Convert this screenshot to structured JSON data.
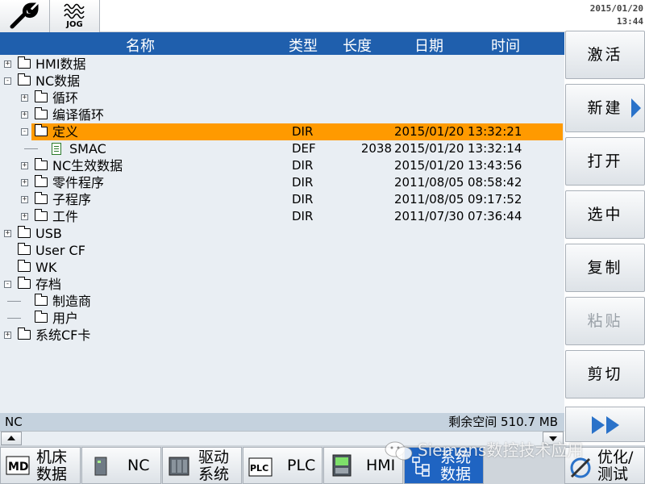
{
  "topbar": {
    "jog_label": "JOG",
    "date": "2015/01/20",
    "time": "13:44"
  },
  "header": {
    "name": "名称",
    "type": "类型",
    "length": "长度",
    "date": "日期",
    "time": "时间"
  },
  "tree": [
    {
      "name": "HMI数据",
      "level": 0,
      "kind": "folder",
      "expander": "+",
      "type": "",
      "length": "",
      "date": "",
      "time": ""
    },
    {
      "name": "NC数据",
      "level": 0,
      "kind": "folder-open",
      "expander": "-",
      "type": "",
      "length": "",
      "date": "",
      "time": ""
    },
    {
      "name": "循环",
      "level": 1,
      "kind": "folder",
      "expander": "+",
      "type": "",
      "length": "",
      "date": "",
      "time": ""
    },
    {
      "name": "编译循环",
      "level": 1,
      "kind": "folder",
      "expander": "+",
      "type": "",
      "length": "",
      "date": "",
      "time": ""
    },
    {
      "name": "定义",
      "level": 1,
      "kind": "folder-open",
      "expander": "-",
      "type": "DIR",
      "length": "",
      "date": "2015/01/20",
      "time": "13:32:21",
      "selected": true
    },
    {
      "name": "SMAC",
      "level": 2,
      "kind": "file",
      "expander": "",
      "type": "DEF",
      "length": "2038",
      "date": "2015/01/20",
      "time": "13:32:14"
    },
    {
      "name": "NC生效数据",
      "level": 1,
      "kind": "folder",
      "expander": "+",
      "type": "DIR",
      "length": "",
      "date": "2015/01/20",
      "time": "13:43:56"
    },
    {
      "name": "零件程序",
      "level": 1,
      "kind": "folder",
      "expander": "+",
      "type": "DIR",
      "length": "",
      "date": "2011/08/05",
      "time": "08:58:42"
    },
    {
      "name": "子程序",
      "level": 1,
      "kind": "folder",
      "expander": "+",
      "type": "DIR",
      "length": "",
      "date": "2011/08/05",
      "time": "09:17:52"
    },
    {
      "name": "工件",
      "level": 1,
      "kind": "folder",
      "expander": "+",
      "type": "DIR",
      "length": "",
      "date": "2011/07/30",
      "time": "07:36:44"
    },
    {
      "name": "USB",
      "level": 0,
      "kind": "folder",
      "expander": "+",
      "type": "",
      "length": "",
      "date": "",
      "time": ""
    },
    {
      "name": "User CF",
      "level": 0,
      "kind": "folder",
      "expander": "",
      "type": "",
      "length": "",
      "date": "",
      "time": ""
    },
    {
      "name": "WK",
      "level": 0,
      "kind": "folder",
      "expander": "",
      "type": "",
      "length": "",
      "date": "",
      "time": ""
    },
    {
      "name": "存档",
      "level": 0,
      "kind": "folder-open",
      "expander": "-",
      "type": "",
      "length": "",
      "date": "",
      "time": ""
    },
    {
      "name": "制造商",
      "level": 1,
      "kind": "folder",
      "expander": "",
      "type": "",
      "length": "",
      "date": "",
      "time": ""
    },
    {
      "name": "用户",
      "level": 1,
      "kind": "folder",
      "expander": "",
      "type": "",
      "length": "",
      "date": "",
      "time": ""
    },
    {
      "name": "系统CF卡",
      "level": 0,
      "kind": "folder",
      "expander": "+",
      "type": "",
      "length": "",
      "date": "",
      "time": ""
    }
  ],
  "status": {
    "left": "NC",
    "right": "剩余空间 510.7 MB"
  },
  "softkeys": [
    "激活",
    "新建",
    "打开",
    "选中",
    "复制",
    "粘贴",
    "剪切"
  ],
  "hkeys": {
    "machine": [
      "机床",
      "数据"
    ],
    "nc": "NC",
    "drive": [
      "驱动",
      "系统"
    ],
    "plc": "PLC",
    "hmi": "HMI",
    "system": [
      "系统",
      "数据"
    ],
    "optimize": [
      "优化/",
      "测试"
    ]
  },
  "watermark": "Siemens数控技术应用",
  "colors": {
    "header": "#1f5fad",
    "selection": "#ff9a00",
    "active_key": "#1f64c2"
  }
}
